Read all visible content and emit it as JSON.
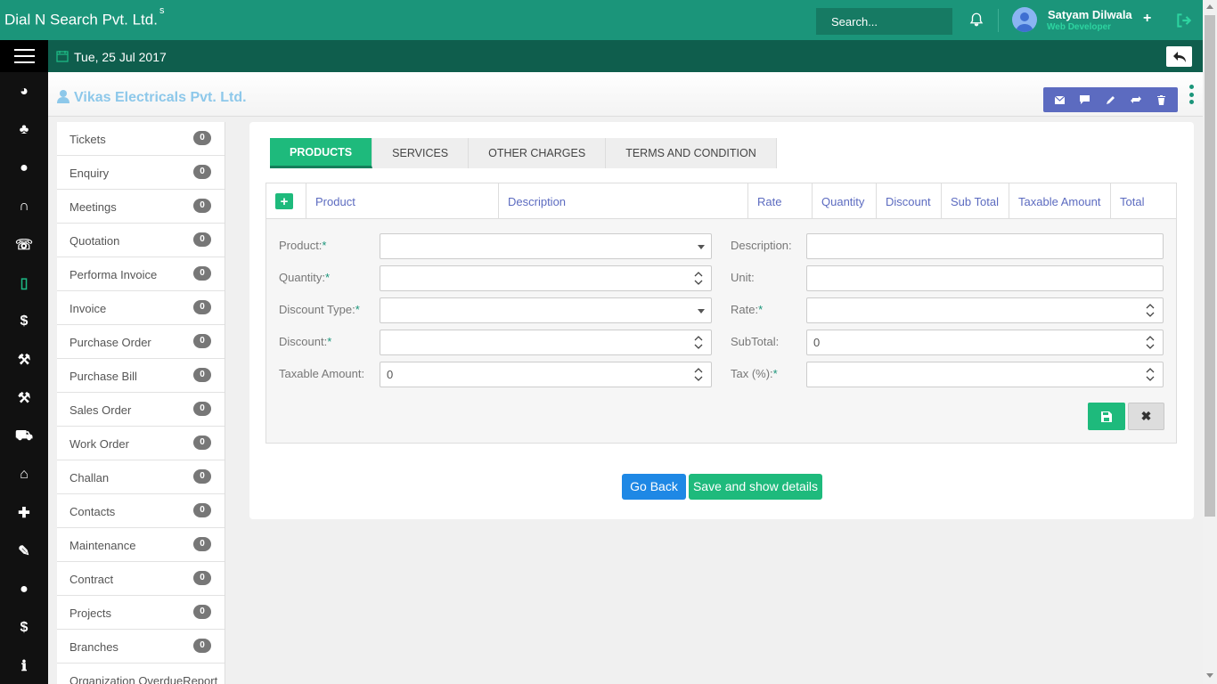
{
  "header": {
    "brand": "Dial N Search Pvt. Ltd.",
    "brand_sup": "s",
    "search_placeholder": "Search...",
    "user_name": "Satyam Dilwala",
    "user_role": "Web Developer",
    "plus_label": "+"
  },
  "datebar": {
    "date": "Tue, 25 Jul 2017"
  },
  "page": {
    "company": "Vikas Electricals Pvt. Ltd."
  },
  "sidebar_icons": [
    {
      "icon": "dashboard-icon",
      "glyph": "◕"
    },
    {
      "icon": "hierarchy-icon",
      "glyph": "♣"
    },
    {
      "icon": "user-icon",
      "glyph": "●"
    },
    {
      "icon": "headset-icon",
      "glyph": "∩"
    },
    {
      "icon": "phone-icon",
      "glyph": "☏"
    },
    {
      "icon": "pdf-file-icon",
      "glyph": "▯"
    },
    {
      "icon": "dollar-icon",
      "glyph": "$"
    },
    {
      "icon": "gavel-icon",
      "glyph": "⚒"
    },
    {
      "icon": "gavel-icon-2",
      "glyph": "⚒"
    },
    {
      "icon": "truck-icon",
      "glyph": "⛟"
    },
    {
      "icon": "basket-icon",
      "glyph": "⌂"
    },
    {
      "icon": "puzzle-icon",
      "glyph": "✚"
    },
    {
      "icon": "wrench-icon",
      "glyph": "✎"
    },
    {
      "icon": "user-icon-2",
      "glyph": "●"
    },
    {
      "icon": "dollar-icon-2",
      "glyph": "$"
    },
    {
      "icon": "info-icon",
      "glyph": "ℹ"
    }
  ],
  "modules": [
    {
      "label": "Tickets",
      "count": "0"
    },
    {
      "label": "Enquiry",
      "count": "0"
    },
    {
      "label": "Meetings",
      "count": "0"
    },
    {
      "label": "Quotation",
      "count": "0"
    },
    {
      "label": "Performa Invoice",
      "count": "0"
    },
    {
      "label": "Invoice",
      "count": "0"
    },
    {
      "label": "Purchase Order",
      "count": "0"
    },
    {
      "label": "Purchase Bill",
      "count": "0"
    },
    {
      "label": "Sales Order",
      "count": "0"
    },
    {
      "label": "Work Order",
      "count": "0"
    },
    {
      "label": "Challan",
      "count": "0"
    },
    {
      "label": "Contacts",
      "count": "0"
    },
    {
      "label": "Maintenance",
      "count": "0"
    },
    {
      "label": "Contract",
      "count": "0"
    },
    {
      "label": "Projects",
      "count": "0"
    },
    {
      "label": "Branches",
      "count": "0"
    },
    {
      "label": "Organization OverdueReport",
      "count": ""
    }
  ],
  "tabs": [
    "PRODUCTS",
    "SERVICES",
    "OTHER CHARGES",
    "TERMS AND CONDITION"
  ],
  "grid": {
    "add_label": "+",
    "columns": [
      "Product",
      "Description",
      "Rate",
      "Quantity",
      "Discount",
      "Sub Total",
      "Taxable Amount",
      "Total"
    ]
  },
  "form": {
    "product_label": "Product:",
    "quantity_label": "Quantity:",
    "discount_type_label": "Discount Type:",
    "discount_label": "Discount:",
    "discount_value": "",
    "taxable_label": "Taxable Amount:",
    "taxable_value": "0",
    "description_label": "Description:",
    "unit_label": "Unit:",
    "rate_label": "Rate:",
    "subtotal_label": "SubTotal:",
    "subtotal_value": "0",
    "tax_label": "Tax (%):",
    "required_mark": "*",
    "cancel_glyph": "✖"
  },
  "buttons": {
    "go_back": "Go Back",
    "save_show": "Save and show details"
  },
  "colors": {
    "brand_green": "#1b957a",
    "dark_green": "#0f5e4d",
    "tab_green": "#1eba7c",
    "action_blue": "#5c6bc0",
    "go_back_blue": "#1e88e5",
    "company_color": "#8dc8ea"
  }
}
